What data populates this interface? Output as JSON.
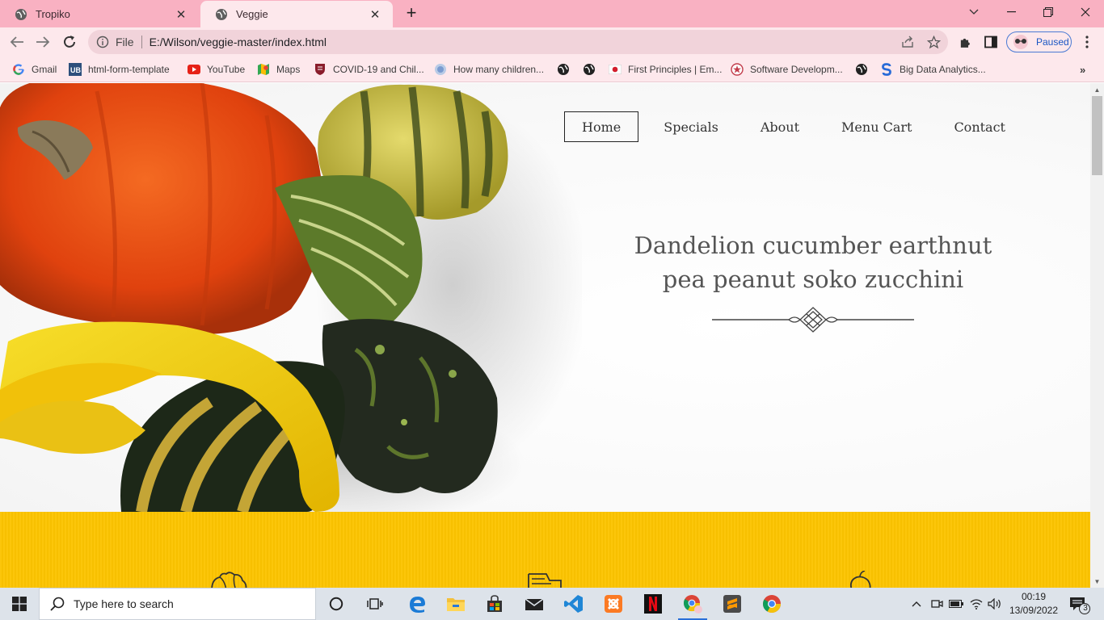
{
  "browser": {
    "tabs": [
      {
        "title": "Tropiko",
        "active": false
      },
      {
        "title": "Veggie",
        "active": true
      }
    ],
    "address": {
      "scheme": "File",
      "url": "E:/Wilson/veggie-master/index.html"
    },
    "profile_label": "Paused",
    "bookmarks": [
      {
        "label": "Gmail",
        "icon": "google-icon"
      },
      {
        "label": "html-form-template",
        "icon": "ub-icon"
      },
      {
        "label": "YouTube",
        "icon": "youtube-icon"
      },
      {
        "label": "Maps",
        "icon": "maps-icon"
      },
      {
        "label": "COVID-19 and Chil...",
        "icon": "shield-icon"
      },
      {
        "label": "How many children...",
        "icon": "globe-icon"
      },
      {
        "label": "",
        "icon": "globe-icon"
      },
      {
        "label": "",
        "icon": "globe-icon"
      },
      {
        "label": "First Principles | Em...",
        "icon": "flag-icon"
      },
      {
        "label": "Software Developm...",
        "icon": "star-badge-icon"
      },
      {
        "label": "",
        "icon": "globe-icon"
      },
      {
        "label": "Big Data Analytics...",
        "icon": "s-logo-icon"
      }
    ]
  },
  "site": {
    "nav": [
      "Home",
      "Specials",
      "About",
      "Menu Cart",
      "Contact"
    ],
    "active_nav": "Home",
    "hero_title_line1": "Dandelion cucumber earthnut",
    "hero_title_line2": "pea peanut soko zucchini",
    "band_color": "#fcc400"
  },
  "taskbar": {
    "search_placeholder": "Type here to search",
    "time": "00:19",
    "date": "13/09/2022",
    "notification_count": "3",
    "apps": [
      "cortana-icon",
      "task-view-icon",
      "edge-icon",
      "file-explorer-icon",
      "store-icon",
      "mail-icon",
      "vscode-icon",
      "xampp-icon",
      "netflix-icon",
      "chrome-profile-icon",
      "sublime-icon",
      "chrome-icon"
    ]
  }
}
